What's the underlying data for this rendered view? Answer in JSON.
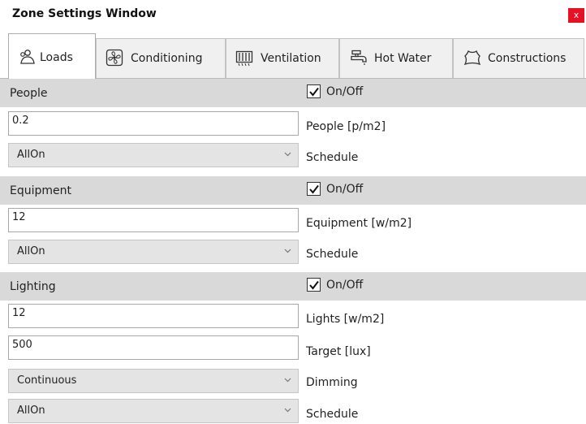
{
  "window": {
    "title": "Zone Settings Window",
    "close_label": "x"
  },
  "tabs": [
    {
      "label": "Loads",
      "icon": "people-icon",
      "active": true
    },
    {
      "label": "Conditioning",
      "icon": "fan-icon",
      "active": false
    },
    {
      "label": "Ventilation",
      "icon": "vent-icon",
      "active": false
    },
    {
      "label": "Hot Water",
      "icon": "faucet-icon",
      "active": false
    },
    {
      "label": "Constructions",
      "icon": "construction-icon",
      "active": false
    }
  ],
  "people": {
    "title": "People",
    "enabled": true,
    "enabled_label": "On/Off",
    "density_value": "0.2",
    "density_label": "People [p/m2]",
    "schedule_value": "AllOn",
    "schedule_label": "Schedule"
  },
  "equipment": {
    "title": "Equipment",
    "enabled": true,
    "enabled_label": "On/Off",
    "density_value": "12",
    "density_label": "Equipment [w/m2]",
    "schedule_value": "AllOn",
    "schedule_label": "Schedule"
  },
  "lighting": {
    "title": "Lighting",
    "enabled": true,
    "enabled_label": "On/Off",
    "density_value": "12",
    "density_label": "Lights [w/m2]",
    "target_value": "500",
    "target_label": "Target [lux]",
    "dimming_value": "Continuous",
    "dimming_label": "Dimming",
    "schedule_value": "AllOn",
    "schedule_label": "Schedule"
  },
  "colors": {
    "close_button": "#e81123",
    "section_header": "#d9d9d9",
    "dropdown": "#e4e4e4"
  }
}
